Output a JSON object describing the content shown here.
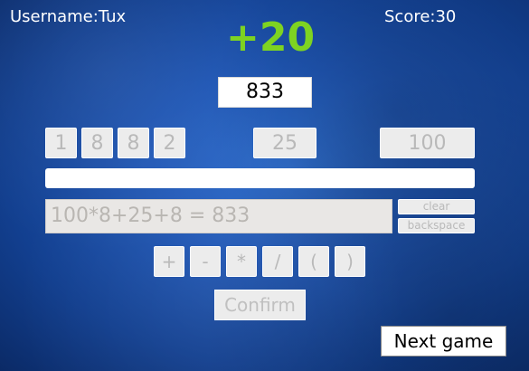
{
  "header": {
    "username_label": "Username:Tux",
    "score_label": "Score:30"
  },
  "result": {
    "points_delta": "+20"
  },
  "target": {
    "value": "833"
  },
  "numbers": [
    "1",
    "8",
    "8",
    "2",
    "25",
    "100"
  ],
  "expression": {
    "value": "100*8+25+8 = 833"
  },
  "edit_buttons": {
    "clear": "clear",
    "backspace": "backspace"
  },
  "operators": [
    "+",
    "-",
    "*",
    "/",
    "(",
    ")"
  ],
  "actions": {
    "confirm": "Confirm",
    "next_game": "Next game"
  },
  "colors": {
    "points_delta": "#7ed321",
    "background": "#1f56b4"
  }
}
